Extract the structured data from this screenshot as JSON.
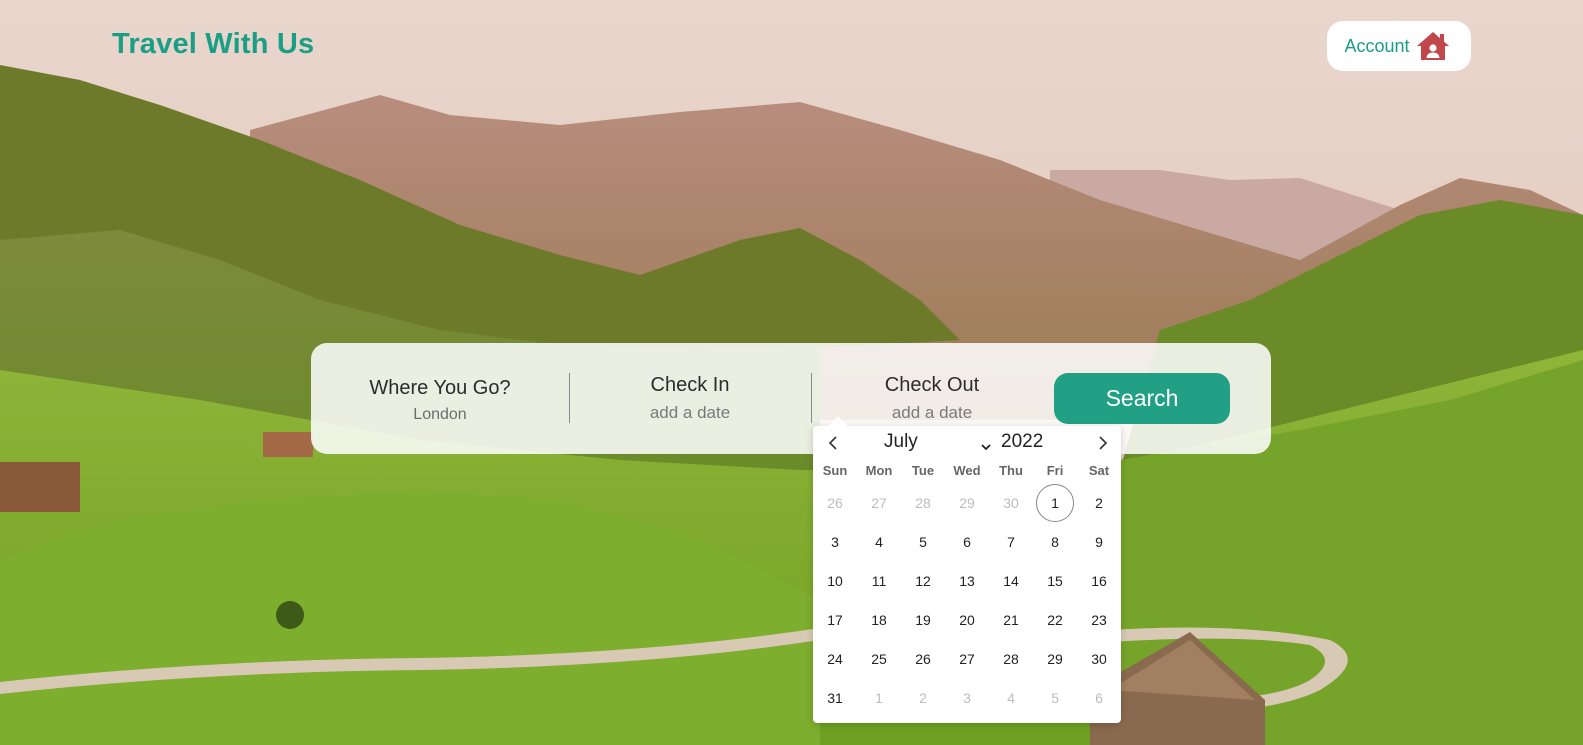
{
  "header": {
    "brand": "Travel With Us",
    "account_label": "Account"
  },
  "icons": {
    "account": "house-user-icon",
    "prev": "chevron-left-icon",
    "next": "chevron-right-icon",
    "month_dropdown": "chevron-down-icon"
  },
  "colors": {
    "brand": "#1a9e86",
    "search_button": "#22a086",
    "account_icon": "#c0474a"
  },
  "search": {
    "where_title": "Where You Go?",
    "where_value": "London",
    "checkin_title": "Check In",
    "checkin_placeholder": "add a date",
    "checkout_title": "Check Out",
    "checkout_placeholder": "add a date",
    "button_label": "Search"
  },
  "calendar": {
    "month": "July",
    "year": "2022",
    "weekdays": [
      "Sun",
      "Mon",
      "Tue",
      "Wed",
      "Thu",
      "Fri",
      "Sat"
    ],
    "weeks": [
      [
        {
          "d": "26",
          "m": true
        },
        {
          "d": "27",
          "m": true
        },
        {
          "d": "28",
          "m": true
        },
        {
          "d": "29",
          "m": true
        },
        {
          "d": "30",
          "m": true
        },
        {
          "d": "1",
          "t": true
        },
        {
          "d": "2"
        }
      ],
      [
        {
          "d": "3"
        },
        {
          "d": "4"
        },
        {
          "d": "5"
        },
        {
          "d": "6"
        },
        {
          "d": "7"
        },
        {
          "d": "8"
        },
        {
          "d": "9"
        }
      ],
      [
        {
          "d": "10"
        },
        {
          "d": "11"
        },
        {
          "d": "12"
        },
        {
          "d": "13"
        },
        {
          "d": "14"
        },
        {
          "d": "15"
        },
        {
          "d": "16"
        }
      ],
      [
        {
          "d": "17"
        },
        {
          "d": "18"
        },
        {
          "d": "19"
        },
        {
          "d": "20"
        },
        {
          "d": "21"
        },
        {
          "d": "22"
        },
        {
          "d": "23"
        }
      ],
      [
        {
          "d": "24"
        },
        {
          "d": "25"
        },
        {
          "d": "26"
        },
        {
          "d": "27"
        },
        {
          "d": "28"
        },
        {
          "d": "29"
        },
        {
          "d": "30"
        }
      ],
      [
        {
          "d": "31"
        },
        {
          "d": "1",
          "m": true
        },
        {
          "d": "2",
          "m": true
        },
        {
          "d": "3",
          "m": true
        },
        {
          "d": "4",
          "m": true
        },
        {
          "d": "5",
          "m": true
        },
        {
          "d": "6",
          "m": true
        }
      ]
    ]
  }
}
